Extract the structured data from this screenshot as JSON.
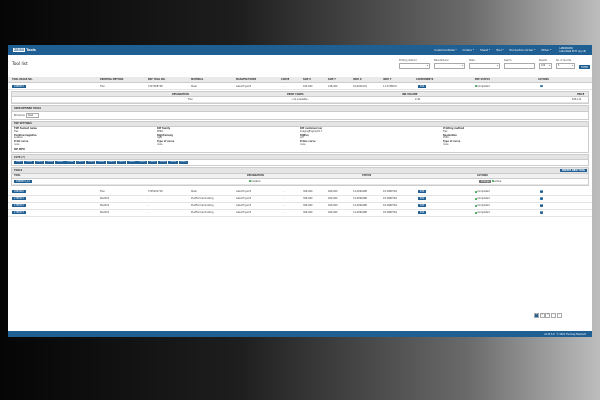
{
  "header": {
    "logo_mark": "ZEISS",
    "logo_text": "Tools",
    "nav": [
      "CustomerData",
      "Orders",
      "Sheet",
      "Tool",
      "Production Order",
      "Other"
    ],
    "user_name": "LABORDATA",
    "user_company": "LaborData ELTY (Lg nP)"
  },
  "page": {
    "title": "Tool list"
  },
  "filters": {
    "printing_method": {
      "label": "Printing method",
      "value": ""
    },
    "manufacturer": {
      "label": "Manufacturer",
      "value": ""
    },
    "state": {
      "label": "State",
      "value": ""
    },
    "search": {
      "label": "Search",
      "value": ""
    },
    "results": {
      "label": "Results",
      "value": "100"
    },
    "no_of_results": {
      "label": "No. of records",
      "value": "5"
    },
    "button": "FILTER"
  },
  "table": {
    "headers": [
      "TOOL IMAGE NO.",
      "PRINTING METHOD",
      "ERP TOOL NO.",
      "MATERIAL",
      "MANUFACTURER",
      "CURVE",
      "SIZE X",
      "SIZE Y",
      "INCH X",
      "INCH Y",
      "COMPONENTS",
      "ERP STATUS",
      "ACTIONS"
    ],
    "row": {
      "id": "1888874",
      "method": "Flex",
      "erp": "3707308738",
      "material": "Steel",
      "manufacturer": "LaborEnyo23",
      "curve": "-",
      "size_x": "424,000",
      "size_y": "236,000",
      "inch_x": "16,6929134",
      "inch_y": "11,5748031",
      "comp": "Edit",
      "status": "Completed"
    }
  },
  "sub_table": {
    "headers": [
      "DESIGNATION",
      "PRINT CODES",
      "INK VOLUME",
      "PRICE"
    ],
    "row": {
      "designation": "Flex",
      "print_codes": "- not available -",
      "ink_volume": "2,40",
      "price": "645,111"
    }
  },
  "user_defined": {
    "title": "USER DEFINED TOOLS",
    "label": "Brickzone",
    "value": "Desk"
  },
  "tdp": {
    "title": "TDP SETTINGS",
    "items": [
      {
        "label": "TDP toolset name",
        "value": "Flex"
      },
      {
        "label": "RIP family",
        "value": "ZERO"
      },
      {
        "label": "RIP customer/ver",
        "value": "ImagingEngine/18.7"
      },
      {
        "label": "Printing method",
        "value": "Flex"
      },
      {
        "label": "Positive/negative",
        "value": "positive"
      },
      {
        "label": "Right/wrong",
        "value": "right"
      },
      {
        "label": "Stiffen",
        "value": "pdf"
      },
      {
        "label": "Resolution",
        "value": "2540"
      },
      {
        "label": "Print curve",
        "value": "none"
      },
      {
        "label": "Type of curve",
        "value": "none"
      },
      {
        "label": "Prime curve",
        "value": "none"
      },
      {
        "label": "Type of curve",
        "value": "none"
      }
    ],
    "rip_info": "RIP INFO"
  },
  "cuts": {
    "title": "CUTS (7)",
    "chips": [
      "T-0001",
      "T-0002",
      "T-0003",
      "T-0004",
      "T-0005",
      "T-0006",
      "T-0007",
      "T-0008",
      "T-0009",
      "T-0010",
      "T-0011",
      "T-0012",
      "T-0013",
      "T-0014",
      "T-0015",
      "T-0016",
      "T-0017"
    ]
  },
  "tools": {
    "title": "TOOLS",
    "create_button": "CREATE NEW TOOL",
    "headers": [
      "TOOL",
      "DESIGNATION",
      "STATUS",
      "ACTIONS"
    ],
    "sub_row": {
      "tool": "1888874_A1",
      "designation": "Created",
      "status": "",
      "action_grey": "Change",
      "action_active": "Active"
    },
    "rows": [
      {
        "id": "1883891",
        "method": "Flex",
        "erp": "3705291718",
        "material": "Steel",
        "manufacturer": "LaborEnyo23",
        "curve": "-",
        "size_x": "366,000",
        "size_y": "460,000",
        "inch_x": "14,4094488",
        "inch_y": "18,1889764",
        "comp": "Edit",
        "status": "Completed"
      },
      {
        "id": "1786971",
        "method": "Medfold",
        "erp": "-",
        "material": "PostFold laminating",
        "manufacturer": "LaborEnyo23",
        "curve": "-",
        "size_x": "366,000",
        "size_y": "460,000",
        "inch_x": "14,4094488",
        "inch_y": "18,1889764",
        "comp": "Edit",
        "status": "Completed"
      },
      {
        "id": "1786972",
        "method": "Medfold",
        "erp": "-",
        "material": "PostFold laminating",
        "manufacturer": "LaborEnyo23",
        "curve": "-",
        "size_x": "366,000",
        "size_y": "460,000",
        "inch_x": "14,4094488",
        "inch_y": "18,1889764",
        "comp": "Edit",
        "status": "Completed"
      },
      {
        "id": "1786973",
        "method": "Medfold",
        "erp": "-",
        "material": "PostFold laminating",
        "manufacturer": "LaborEnyo23",
        "curve": "-",
        "size_x": "366,000",
        "size_y": "460,000",
        "inch_x": "14,4094488",
        "inch_y": "18,1889764",
        "comp": "Edit",
        "status": "Completed"
      }
    ]
  },
  "pagination": {
    "pages": [
      "1",
      "2",
      "3"
    ],
    "next": "›",
    "last": "»"
  },
  "footer": {
    "version": "v6.15.5.8",
    "copyright": "© 2024 The Grey Elephant"
  },
  "colors": {
    "primary": "#1f5f94",
    "success": "#3aa64a"
  }
}
